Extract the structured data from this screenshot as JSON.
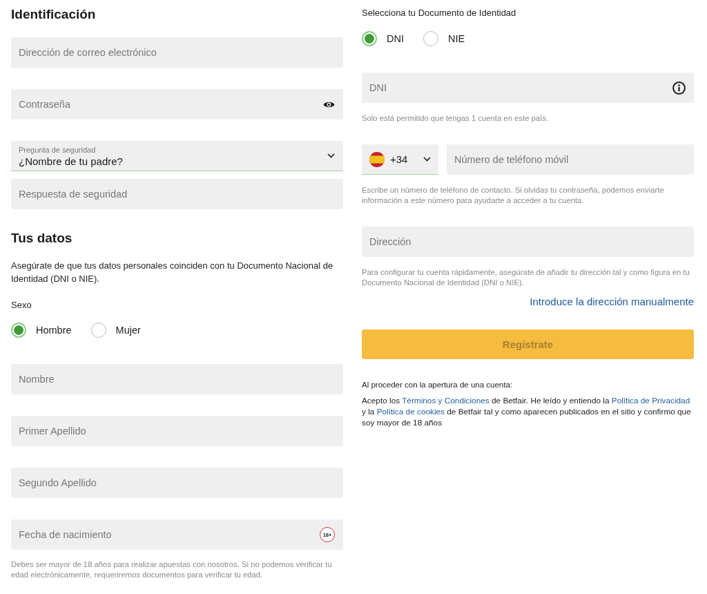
{
  "identification": {
    "title": "Identificación",
    "fields": [
      {
        "kind": "text",
        "placeholder": "Dirección de correo electrónico"
      },
      {
        "kind": "password",
        "placeholder": "Contraseña"
      },
      {
        "kind": "select",
        "label": "Pregunta de seguridad",
        "value": "¿Nombre de tu padre?"
      },
      {
        "kind": "text",
        "placeholder": "Respuesta de seguridad"
      }
    ]
  },
  "personal_data": {
    "title": "Tus datos",
    "intro": "Asegúrate de que tus datos personales coinciden con tu Documento Nacional de Identidad (DNI o NIE).",
    "gender": {
      "label": "Sexo",
      "options": [
        {
          "label": "Hombre",
          "selected": true
        },
        {
          "label": "Mujer",
          "selected": false
        }
      ]
    },
    "fields": [
      {
        "kind": "text",
        "placeholder": "Nombre"
      },
      {
        "kind": "text",
        "placeholder": "Primer Apellido"
      },
      {
        "kind": "text",
        "placeholder": "Segundo Apellido"
      },
      {
        "kind": "date",
        "placeholder": "Fecha de nacimiento",
        "badge": "18+"
      }
    ],
    "note": "Debes ser mayor de 18 años para realizar apuestas con nosotros. Si no podemos verificar tu edad electrónicamente, requeriremos documentos para verificar tu edad."
  },
  "document": {
    "label": "Selecciona tu Documento de Identidad",
    "options": [
      {
        "label": "DNI",
        "selected": true
      },
      {
        "label": "NIE",
        "selected": false
      }
    ],
    "field": {
      "kind": "document",
      "placeholder": "DNI"
    },
    "note": "Solo está permitido que tengas 1 cuenta en este país."
  },
  "phone": {
    "country_code": "+34",
    "placeholder": "Número de teléfono móvil",
    "note": "Escribe un número de teléfono de contacto. Si olvidas tu contraseña, podemos enviarte información a este número para ayudarte a acceder a tu cuenta."
  },
  "address": {
    "placeholder": "Dirección",
    "note": "Para configurar tu cuenta rápidamente, asegúrate de añadir tu dirección tal y como figura en tu Documento Nacional de Identidad (DNI o NIE).",
    "manual_link": "Introduce la dirección manualmente"
  },
  "register_button": {
    "label": "Regístrate",
    "disabled": true
  },
  "terms": {
    "intro": "Al proceder con la apertura de una cuenta:",
    "parts": [
      {
        "kind": "text",
        "text": "Acepto los "
      },
      {
        "kind": "link",
        "text": "Términos y Condiciones"
      },
      {
        "kind": "text",
        "text": " de Betfair. He leído y entiendo la "
      },
      {
        "kind": "link",
        "text": "Política de Privacidad"
      },
      {
        "kind": "text",
        "text": " y la "
      },
      {
        "kind": "link",
        "text": "Política de cookies"
      },
      {
        "kind": "text",
        "text": " de Betfair tal y como aparecen publicados en el sitio y confirmo que soy mayor de 18 años"
      }
    ]
  }
}
